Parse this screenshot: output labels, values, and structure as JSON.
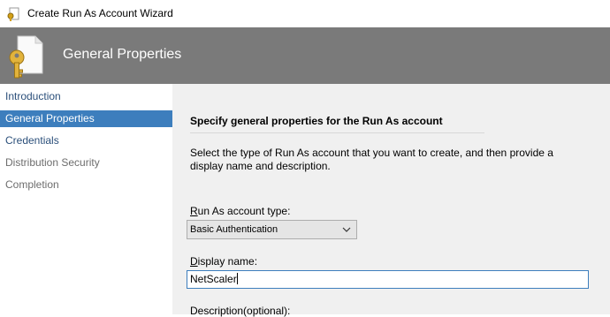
{
  "window": {
    "title": "Create Run As Account Wizard"
  },
  "banner": {
    "heading": "General Properties"
  },
  "sidebar": {
    "items": [
      {
        "label": "Introduction",
        "state": "normal"
      },
      {
        "label": "General Properties",
        "state": "active"
      },
      {
        "label": "Credentials",
        "state": "normal"
      },
      {
        "label": "Distribution Security",
        "state": "disabled"
      },
      {
        "label": "Completion",
        "state": "disabled"
      }
    ]
  },
  "main": {
    "section_title": "Specify general properties for the Run As account",
    "description": "Select the type of Run As account that you want to create, and then provide a display name and description.",
    "account_type": {
      "label_underlined": "R",
      "label_rest": "un As account type:",
      "selected": "Basic Authentication"
    },
    "display_name": {
      "label_underlined": "D",
      "label_rest": "isplay name:",
      "value": "NetScaler"
    },
    "description_field": {
      "label": "Description(optional):"
    }
  },
  "colors": {
    "banner": "#7a7a7a",
    "active_item": "#3d7ebd",
    "link_item": "#2b4f7a",
    "disabled_item": "#6d6d6d",
    "content_bg": "#f0f0f0"
  }
}
